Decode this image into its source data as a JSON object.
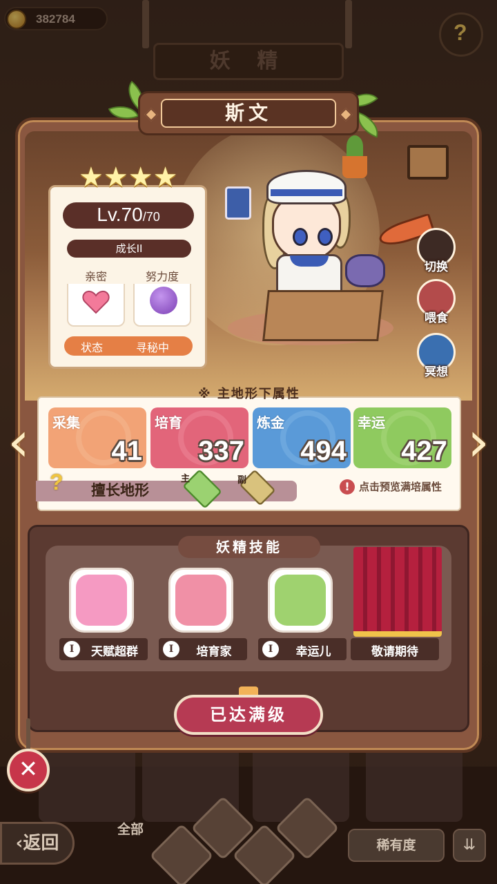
{
  "top": {
    "coins": "382784",
    "category_title": "妖 精",
    "help_glyph": "?"
  },
  "fairy": {
    "name": "斯文",
    "stars": [
      "★",
      "★",
      "★",
      "★"
    ],
    "level_current": "Lv.70",
    "level_max": "/70",
    "growth": "成长II",
    "intimacy_label": "亲密",
    "effort_label": "努力度",
    "status_label": "状态",
    "status_value": "寻秘中"
  },
  "actions": [
    {
      "label": "切换",
      "icon": "switch-icon"
    },
    {
      "label": "喂食",
      "icon": "meat-icon"
    },
    {
      "label": "冥想",
      "icon": "meditate-icon"
    }
  ],
  "attributes": {
    "header": "※ 主地形下属性",
    "items": [
      {
        "label": "采集",
        "value": "41",
        "color": "#f2a376",
        "deco": "#f7c2a0"
      },
      {
        "label": "培育",
        "value": "337",
        "color": "#e2657a",
        "deco": "#f39aa8"
      },
      {
        "label": "炼金",
        "value": "494",
        "color": "#5a9ad8",
        "deco": "#8ec0ea"
      },
      {
        "label": "幸运",
        "value": "427",
        "color": "#8fca5f",
        "deco": "#b8e08e"
      }
    ],
    "terrain_label": "擅长地形",
    "terrain_main_tag": "主",
    "terrain_sub_tag": "副",
    "preview_tip": "点击预览满培属性",
    "arrow_left": "‹",
    "arrow_right": "›"
  },
  "skills": {
    "title": "妖精技能",
    "items": [
      {
        "name": "天赋超群",
        "rank": "I",
        "color": "#f59ac2",
        "icon": "octopus-face-icon"
      },
      {
        "name": "培育家",
        "rank": "I",
        "color": "#f090a6",
        "icon": "watering-can-icon"
      },
      {
        "name": "幸运儿",
        "rank": "I",
        "color": "#9fd26f",
        "icon": "clover-icon"
      }
    ],
    "coming_soon": "敬请期待"
  },
  "max_button": "已达满级",
  "close_glyph": "✕",
  "bottom": {
    "back_label": "‹返回",
    "all_label": "全部",
    "rarity_label": "稀有度",
    "sort_glyph": "⇊"
  }
}
